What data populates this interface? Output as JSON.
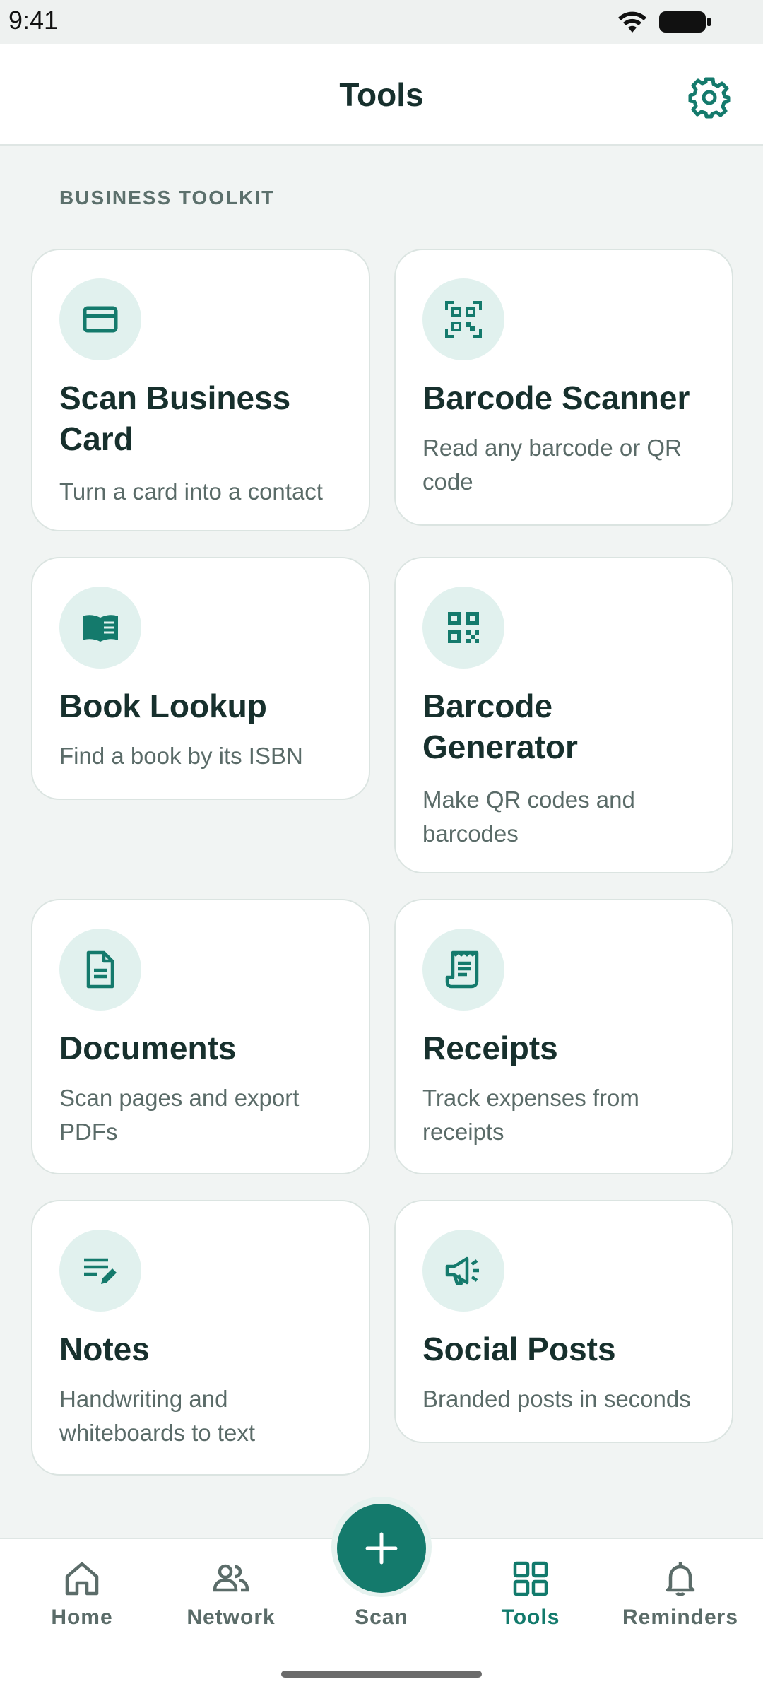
{
  "status_bar": {
    "time": "9:41"
  },
  "header": {
    "title": "Tools",
    "settings_icon": "gear-icon"
  },
  "section": {
    "label": "BUSINESS TOOLKIT"
  },
  "tools": [
    {
      "id": "scan-business-card",
      "icon": "credit-card-icon",
      "title": "Scan Business Card",
      "description": "Turn a card into a contact"
    },
    {
      "id": "barcode-scanner",
      "icon": "qr-scan-icon",
      "title": "Barcode Scanner",
      "description": "Read any barcode or QR code"
    },
    {
      "id": "book-lookup",
      "icon": "open-book-icon",
      "title": "Book Lookup",
      "description": "Find a book by its ISBN"
    },
    {
      "id": "barcode-generator",
      "icon": "qr-code-icon",
      "title": "Barcode Generator",
      "description": "Make QR codes and barcodes"
    },
    {
      "id": "documents",
      "icon": "document-icon",
      "title": "Documents",
      "description": "Scan pages and export PDFs"
    },
    {
      "id": "receipts",
      "icon": "receipt-icon",
      "title": "Receipts",
      "description": "Track expenses from receipts"
    },
    {
      "id": "notes",
      "icon": "notes-pen-icon",
      "title": "Notes",
      "description": "Handwriting and whiteboards to text"
    },
    {
      "id": "social-posts",
      "icon": "megaphone-icon",
      "title": "Social Posts",
      "description": "Branded posts in seconds"
    }
  ],
  "bottom_nav": {
    "items": [
      {
        "label": "Home",
        "icon": "home-icon"
      },
      {
        "label": "Network",
        "icon": "people-icon"
      },
      {
        "label": "Scan",
        "icon": "plus-icon"
      },
      {
        "label": "Tools",
        "icon": "grid-icon",
        "active": true
      },
      {
        "label": "Reminders",
        "icon": "bell-icon"
      }
    ]
  },
  "colors": {
    "accent": "#147a6c",
    "background": "#f1f4f3",
    "card": "#ffffff",
    "icon_circle": "#e1f1ee",
    "text_primary": "#17302d",
    "text_secondary": "#5a6b68"
  }
}
